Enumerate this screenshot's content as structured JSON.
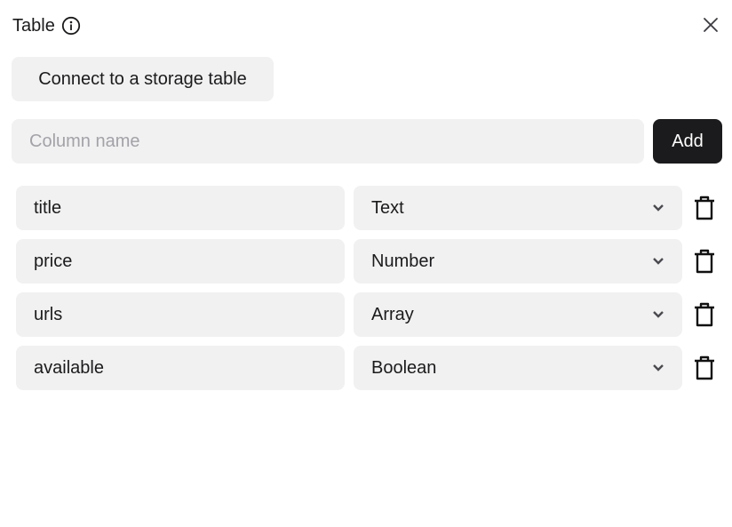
{
  "header": {
    "title": "Table",
    "info_icon": "info-icon",
    "close_icon": "close-icon"
  },
  "connect_button": {
    "label": "Connect to a storage table"
  },
  "new_column": {
    "value": "",
    "placeholder": "Column name",
    "add_label": "Add"
  },
  "columns": [
    {
      "name": "title",
      "type": "Text"
    },
    {
      "name": "price",
      "type": "Number"
    },
    {
      "name": "urls",
      "type": "Array"
    },
    {
      "name": "available",
      "type": "Boolean"
    }
  ],
  "colors": {
    "field_bg": "#f1f1f1",
    "primary_button": "#1b1b1d",
    "placeholder": "#a2a2a8"
  }
}
